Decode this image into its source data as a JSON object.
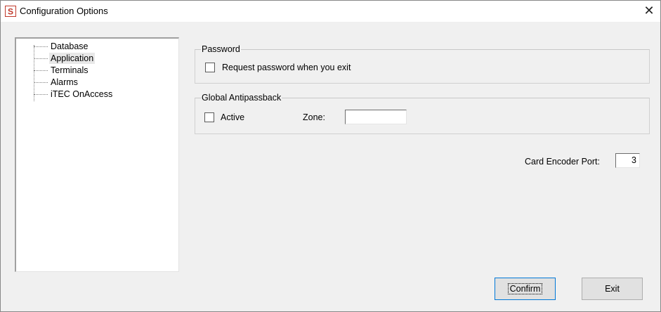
{
  "window": {
    "title": "Configuration Options",
    "close_symbol": "✕"
  },
  "tree": {
    "items": [
      {
        "label": "Database"
      },
      {
        "label": "Application",
        "selected": true
      },
      {
        "label": "Terminals"
      },
      {
        "label": "Alarms"
      },
      {
        "label": "iTEC OnAccess"
      }
    ]
  },
  "password_group": {
    "legend": "Password",
    "request_password_label": "Request password when you exit",
    "request_password_checked": false
  },
  "antipassback_group": {
    "legend": "Global Antipassback",
    "active_label": "Active",
    "active_checked": false,
    "zone_label": "Zone:",
    "zone_value": ""
  },
  "card_encoder": {
    "label": "Card Encoder Port:",
    "value": "3"
  },
  "buttons": {
    "confirm": "Confirm",
    "exit": "Exit"
  },
  "icons": {
    "app_icon": "s-logo-icon",
    "close": "close-icon"
  },
  "colors": {
    "app_icon_red": "#c0392b"
  }
}
